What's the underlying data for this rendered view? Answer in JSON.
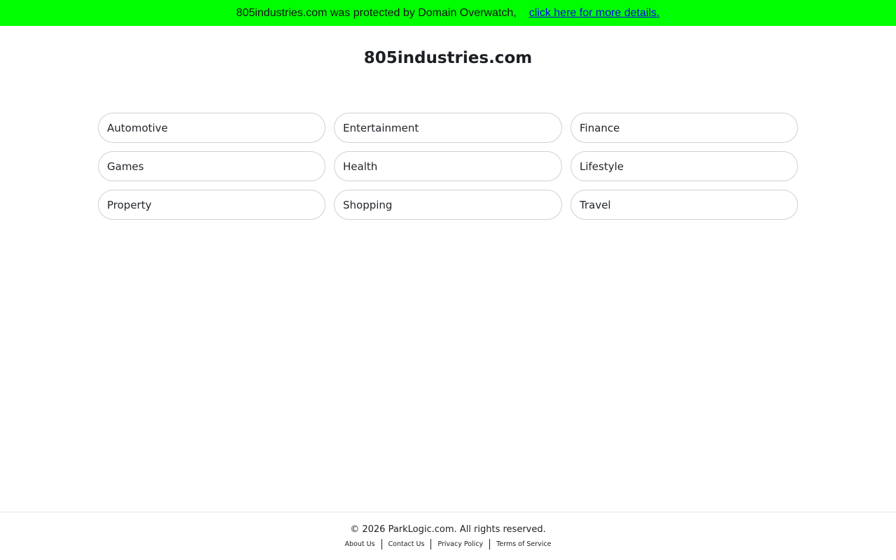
{
  "banner": {
    "text": "805industries.com was protected by Domain Overwatch,",
    "link_label": "click here for more details.",
    "background_color": "#00ff00",
    "link_color": "#0000ee"
  },
  "page": {
    "title": "805industries.com"
  },
  "categories": [
    {
      "label": "Automotive"
    },
    {
      "label": "Entertainment"
    },
    {
      "label": "Finance"
    },
    {
      "label": "Games"
    },
    {
      "label": "Health"
    },
    {
      "label": "Lifestyle"
    },
    {
      "label": "Property"
    },
    {
      "label": "Shopping"
    },
    {
      "label": "Travel"
    }
  ],
  "footer": {
    "copyright": "© 2026 ParkLogic.com. All rights reserved.",
    "links": [
      {
        "label": "About Us"
      },
      {
        "label": "Contact Us"
      },
      {
        "label": "Privacy Policy"
      },
      {
        "label": "Terms of Service"
      }
    ]
  }
}
